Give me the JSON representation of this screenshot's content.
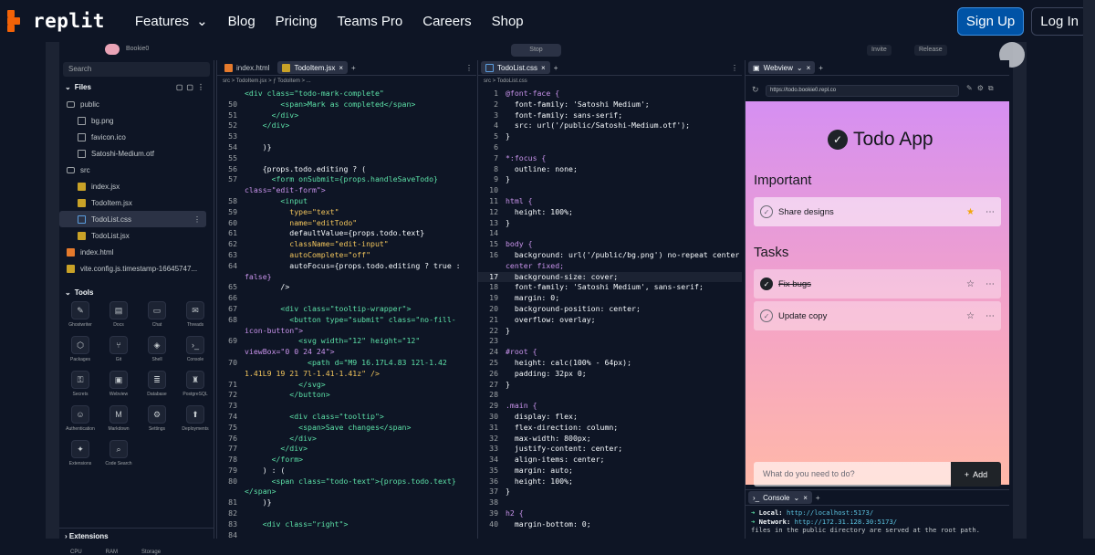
{
  "nav": {
    "logo_text": "replit",
    "items": [
      {
        "label": "Features",
        "has_dropdown": true
      },
      {
        "label": "Blog"
      },
      {
        "label": "Pricing"
      },
      {
        "label": "Teams Pro"
      },
      {
        "label": "Careers"
      },
      {
        "label": "Shop"
      }
    ],
    "signup": "Sign Up",
    "login": "Log In",
    "brand_color": "#f26207"
  },
  "ide": {
    "user": "Bookie0",
    "run_label": "Stop",
    "invite": "Invite",
    "release": "Release",
    "sidebar": {
      "search_placeholder": "Search",
      "files_title": "Files",
      "files": [
        {
          "name": "public",
          "type": "folder",
          "indent": 0
        },
        {
          "name": "bg.png",
          "type": "image",
          "indent": 1
        },
        {
          "name": "favicon.ico",
          "type": "image",
          "indent": 1
        },
        {
          "name": "Satoshi-Medium.otf",
          "type": "file",
          "indent": 1
        },
        {
          "name": "src",
          "type": "folder",
          "indent": 0
        },
        {
          "name": "index.jsx",
          "type": "js",
          "indent": 1
        },
        {
          "name": "TodoItem.jsx",
          "type": "js",
          "indent": 1
        },
        {
          "name": "TodoList.css",
          "type": "css",
          "indent": 1,
          "selected": true
        },
        {
          "name": "TodoList.jsx",
          "type": "js",
          "indent": 1
        },
        {
          "name": "index.html",
          "type": "html",
          "indent": 0
        },
        {
          "name": "vite.config.js.timestamp-16645747...",
          "type": "js",
          "indent": 0
        }
      ],
      "tools_title": "Tools",
      "tools": [
        {
          "label": "Ghostwriter",
          "icon": "ghostwriter-icon",
          "glyph": "✎"
        },
        {
          "label": "Docs",
          "icon": "docs-icon",
          "glyph": "▤"
        },
        {
          "label": "Chat",
          "icon": "chat-icon",
          "glyph": "▭"
        },
        {
          "label": "Threads",
          "icon": "threads-icon",
          "glyph": "✉"
        },
        {
          "label": "Packages",
          "icon": "packages-icon",
          "glyph": "⬡"
        },
        {
          "label": "Git",
          "icon": "git-icon",
          "glyph": "⑂"
        },
        {
          "label": "Shell",
          "icon": "shell-icon",
          "glyph": "◈"
        },
        {
          "label": "Console",
          "icon": "console-icon",
          "glyph": "›_"
        },
        {
          "label": "Secrets",
          "icon": "secrets-icon",
          "glyph": "⚿"
        },
        {
          "label": "Webview",
          "icon": "webview-icon",
          "glyph": "▣"
        },
        {
          "label": "Database",
          "icon": "database-icon",
          "glyph": "≣"
        },
        {
          "label": "PostgreSQL",
          "icon": "postgresql-icon",
          "glyph": "♜"
        },
        {
          "label": "Authentication",
          "icon": "authentication-icon",
          "glyph": "☺"
        },
        {
          "label": "Markdown",
          "icon": "markdown-icon",
          "glyph": "M"
        },
        {
          "label": "Settings",
          "icon": "settings-icon",
          "glyph": "⚙"
        },
        {
          "label": "Deployments",
          "icon": "deployments-icon",
          "glyph": "⬆"
        },
        {
          "label": "Extensions",
          "icon": "extensions-icon",
          "glyph": "✦"
        },
        {
          "label": "Code Search",
          "icon": "code-search-icon",
          "glyph": "⌕"
        }
      ],
      "extensions_title": "Extensions",
      "ext_sub": [
        "CPU",
        "RAM",
        "Storage"
      ]
    },
    "editor1": {
      "tabs": [
        "index.html",
        "TodoItem.jsx"
      ],
      "crumb": "src > TodoItem.jsx > ƒ TodoItem > ...",
      "lines": [
        {
          "n": "",
          "code": "<div class=\"todo-mark-complete\""
        },
        {
          "n": "50",
          "code": "        <span>Mark as completed</span>"
        },
        {
          "n": "51",
          "code": "      </div>"
        },
        {
          "n": "52",
          "code": "    </div>"
        },
        {
          "n": "53",
          "code": ""
        },
        {
          "n": "54",
          "code": "    )}"
        },
        {
          "n": "55",
          "code": ""
        },
        {
          "n": "56",
          "code": "    {props.todo.editing ? ("
        },
        {
          "n": "57",
          "code": "      <form onSubmit={props.handleSaveTodo}"
        },
        {
          "n": "",
          "code": "class=\"edit-form\">"
        },
        {
          "n": "58",
          "code": "        <input"
        },
        {
          "n": "59",
          "code": "          type=\"text\""
        },
        {
          "n": "60",
          "code": "          name=\"editTodo\""
        },
        {
          "n": "61",
          "code": "          defaultValue={props.todo.text}"
        },
        {
          "n": "62",
          "code": "          className=\"edit-input\""
        },
        {
          "n": "63",
          "code": "          autoComplete=\"off\""
        },
        {
          "n": "64",
          "code": "          autoFocus={props.todo.editing ? true :"
        },
        {
          "n": "",
          "code": "false}"
        },
        {
          "n": "65",
          "code": "        />"
        },
        {
          "n": "66",
          "code": ""
        },
        {
          "n": "67",
          "code": "        <div class=\"tooltip-wrapper\">"
        },
        {
          "n": "68",
          "code": "          <button type=\"submit\" class=\"no-fill-"
        },
        {
          "n": "",
          "code": "icon-button\">"
        },
        {
          "n": "69",
          "code": "            <svg width=\"12\" height=\"12\""
        },
        {
          "n": "",
          "code": "viewBox=\"0 0 24 24\">"
        },
        {
          "n": "70",
          "code": "              <path d=\"M9 16.17L4.83 12l-1.42"
        },
        {
          "n": "",
          "code": "1.41L9 19 21 7l-1.41-1.41z\" />"
        },
        {
          "n": "71",
          "code": "            </svg>"
        },
        {
          "n": "72",
          "code": "          </button>"
        },
        {
          "n": "73",
          "code": ""
        },
        {
          "n": "74",
          "code": "          <div class=\"tooltip\">"
        },
        {
          "n": "75",
          "code": "            <span>Save changes</span>"
        },
        {
          "n": "76",
          "code": "          </div>"
        },
        {
          "n": "77",
          "code": "        </div>"
        },
        {
          "n": "78",
          "code": "      </form>"
        },
        {
          "n": "79",
          "code": "    ) : ("
        },
        {
          "n": "80",
          "code": "      <span class=\"todo-text\">{props.todo.text}"
        },
        {
          "n": "",
          "code": "</span>"
        },
        {
          "n": "81",
          "code": "    )}"
        },
        {
          "n": "82",
          "code": ""
        },
        {
          "n": "83",
          "code": "    <div class=\"right\">"
        },
        {
          "n": "84",
          "code": ""
        }
      ]
    },
    "editor2": {
      "tabs": [
        "TodoList.css"
      ],
      "crumb": "src > TodoList.css",
      "lines": [
        {
          "n": "1",
          "code": "@font-face {"
        },
        {
          "n": "2",
          "code": "  font-family: 'Satoshi Medium';"
        },
        {
          "n": "3",
          "code": "  font-family: sans-serif;"
        },
        {
          "n": "4",
          "code": "  src: url('/public/Satoshi-Medium.otf');"
        },
        {
          "n": "5",
          "code": "}"
        },
        {
          "n": "6",
          "code": ""
        },
        {
          "n": "7",
          "code": "*:focus {"
        },
        {
          "n": "8",
          "code": "  outline: none;"
        },
        {
          "n": "9",
          "code": "}"
        },
        {
          "n": "10",
          "code": ""
        },
        {
          "n": "11",
          "code": "html {"
        },
        {
          "n": "12",
          "code": "  height: 100%;"
        },
        {
          "n": "13",
          "code": "}"
        },
        {
          "n": "14",
          "code": ""
        },
        {
          "n": "15",
          "code": "body {"
        },
        {
          "n": "16",
          "code": "  background: url('/public/bg.png') no-repeat center"
        },
        {
          "n": "",
          "code": "center fixed;"
        },
        {
          "n": "17",
          "code": "  background-size: cover;"
        },
        {
          "n": "18",
          "code": "  font-family: 'Satoshi Medium', sans-serif;"
        },
        {
          "n": "19",
          "code": "  margin: 0;"
        },
        {
          "n": "20",
          "code": "  background-position: center;"
        },
        {
          "n": "21",
          "code": "  overflow: overlay;"
        },
        {
          "n": "22",
          "code": "}"
        },
        {
          "n": "23",
          "code": ""
        },
        {
          "n": "24",
          "code": "#root {"
        },
        {
          "n": "25",
          "code": "  height: calc(100% - 64px);"
        },
        {
          "n": "26",
          "code": "  padding: 32px 0;"
        },
        {
          "n": "27",
          "code": "}"
        },
        {
          "n": "28",
          "code": ""
        },
        {
          "n": "29",
          "code": ".main {"
        },
        {
          "n": "30",
          "code": "  display: flex;"
        },
        {
          "n": "31",
          "code": "  flex-direction: column;"
        },
        {
          "n": "32",
          "code": "  max-width: 800px;"
        },
        {
          "n": "33",
          "code": "  justify-content: center;"
        },
        {
          "n": "34",
          "code": "  align-items: center;"
        },
        {
          "n": "35",
          "code": "  margin: auto;"
        },
        {
          "n": "36",
          "code": "  height: 100%;"
        },
        {
          "n": "37",
          "code": "}"
        },
        {
          "n": "38",
          "code": ""
        },
        {
          "n": "39",
          "code": "h2 {"
        },
        {
          "n": "40",
          "code": "  margin-bottom: 0;"
        }
      ]
    },
    "webview": {
      "tab": "Webview",
      "url": "https://todo.bookie0.repl.co",
      "app_title": "Todo App",
      "important_heading": "Important",
      "tasks_heading": "Tasks",
      "important": [
        {
          "text": "Share designs",
          "done": false,
          "starred": true
        }
      ],
      "tasks": [
        {
          "text": "Fix bugs",
          "done": true,
          "starred": false
        },
        {
          "text": "Update copy",
          "done": false,
          "starred": false
        }
      ],
      "add_placeholder": "What do you need to do?",
      "add_label": "Add"
    },
    "console": {
      "tab": "Console",
      "local_label": "Local:",
      "local_url": "http://localhost:5173/",
      "network_label": "Network:",
      "network_url": "http://172.31.128.30:5173/",
      "note": "files in the public directory are served at the root path."
    }
  }
}
